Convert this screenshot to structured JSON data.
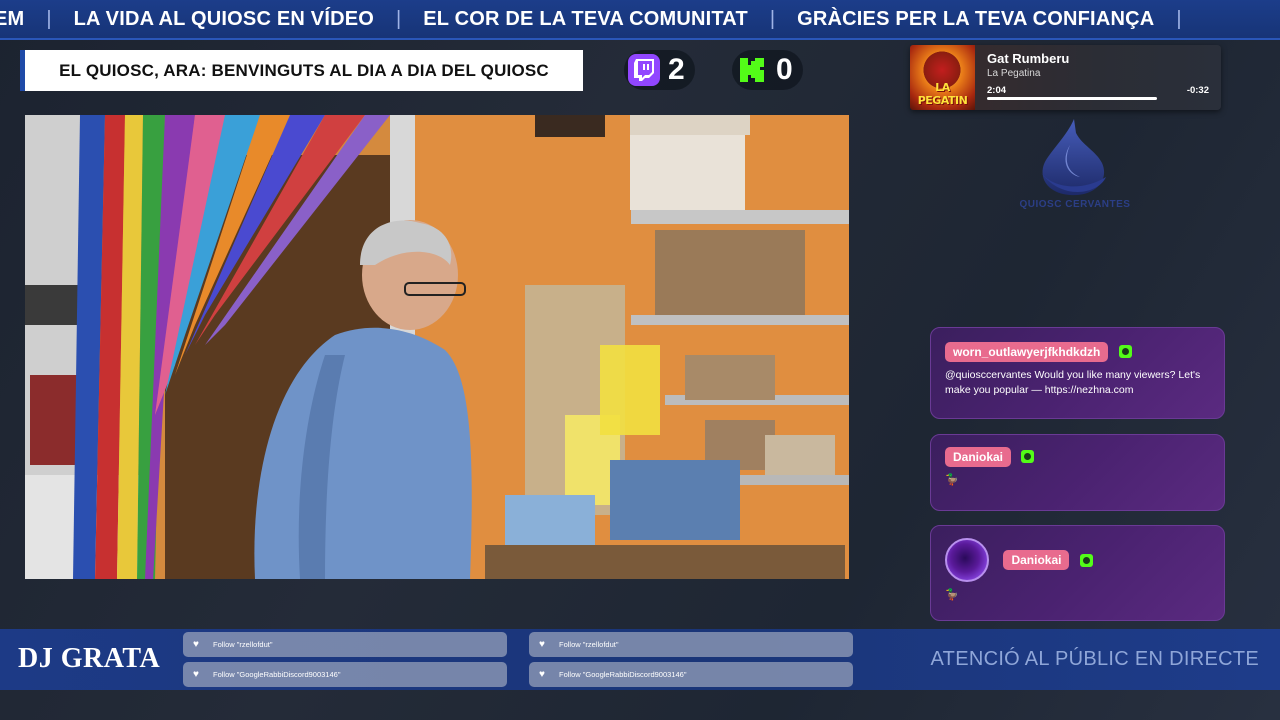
{
  "ticker": {
    "items": [
      "EM",
      "LA VIDA AL QUIOSC EN VÍDEO",
      "EL COR DE LA TEVA COMUNITAT",
      "GRÀCIES PER LA TEVA CONFIANÇA"
    ],
    "separator": "|"
  },
  "title_banner": "EL QUIOSC, ARA: BENVINGUTS AL DIA A DIA DEL QUIOSC",
  "counters": {
    "twitch": "2",
    "kick": "0"
  },
  "now_playing": {
    "track": "Gat Rumberu",
    "artist": "La Pegatina",
    "album_text": "LA PEGATIN",
    "elapsed": "2:04",
    "remaining": "-0:32",
    "progress": 0.795
  },
  "logo": {
    "text": "QUIOSC CERVANTES"
  },
  "chat": [
    {
      "user": "worn_outlawyerjfkhdkdzh",
      "message": "@quiosccervantes Would you like many viewers? Let's make you popular — https://nezhna.com",
      "badge": "kick-badge"
    },
    {
      "user": "Daniokai",
      "message": "🦆",
      "badge": "kick-badge"
    },
    {
      "user": "Daniokai",
      "message": "🦆",
      "badge": "kick-badge",
      "has_avatar": true
    }
  ],
  "bottom": {
    "dj_name": "DJ GRATA",
    "follows": [
      "Follow \"rzellofdut\"",
      "Follow \"GoogleRabbiDiscord9003146\"",
      "Follow \"rzellofdut\"",
      "Follow \"GoogleRabbiDiscord9003146\""
    ],
    "right_text": "ATENCIÓ AL PÚBLIC EN DIRECTE"
  },
  "colors": {
    "ticker_bg": "#1c3d8a",
    "twitch": "#9146ff",
    "kick": "#53fc18",
    "chat_name_bg": "#e86b8e"
  }
}
